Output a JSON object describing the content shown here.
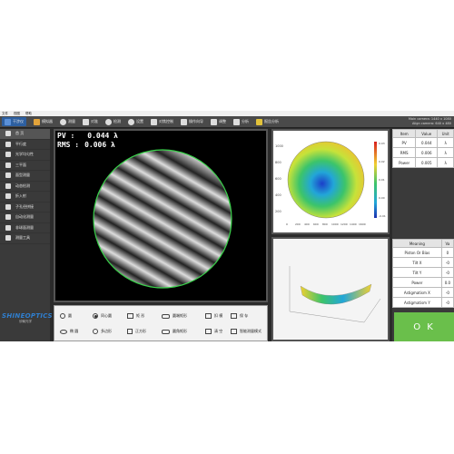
{
  "menubar": {
    "items": [
      "文件",
      "视图",
      "帮助"
    ]
  },
  "toolbar": {
    "items": [
      {
        "label": "干涉仪",
        "icon": "interferometer-icon",
        "active": true
      },
      {
        "label": "模拟器",
        "icon": "simulator-icon",
        "active": false
      },
      {
        "label": "测量",
        "icon": "measure-icon",
        "active": false
      },
      {
        "label": "对准",
        "icon": "align-icon",
        "active": false
      },
      {
        "label": "检测",
        "icon": "detect-icon",
        "active": false
      },
      {
        "label": "设置",
        "icon": "settings-icon",
        "active": false
      },
      {
        "label": "对焦控制",
        "icon": "focus-icon",
        "active": false
      },
      {
        "label": "操作向导",
        "icon": "wizard-icon",
        "active": false
      },
      {
        "label": "调整",
        "icon": "adjust-icon",
        "active": false
      },
      {
        "label": "分析",
        "icon": "analysis-icon",
        "active": false
      },
      {
        "label": "报告分析",
        "icon": "report-icon",
        "active": false
      }
    ],
    "camera_status_1": "Main camera: 1440 x 1080",
    "camera_status_2": "Align camera: 640 x 480"
  },
  "sidebar": {
    "items": [
      {
        "label": "首 页",
        "active": true
      },
      {
        "label": "平行度",
        "active": false
      },
      {
        "label": "光学均匀性",
        "active": false
      },
      {
        "label": "三平面",
        "active": false
      },
      {
        "label": "面型测量",
        "active": false
      },
      {
        "label": "动态检测",
        "active": false
      },
      {
        "label": "折入射",
        "active": false
      },
      {
        "label": "子孔径拼接",
        "active": false
      },
      {
        "label": "自动化测量",
        "active": false
      },
      {
        "label": "非球面测量",
        "active": false
      },
      {
        "label": "测量工具",
        "active": false
      }
    ],
    "logo": "SHINEOPTICS",
    "logo_sub": "欣翰光学"
  },
  "main": {
    "pv_label": "PV :",
    "pv_value": "0.044 λ",
    "rms_label": "RMS :",
    "rms_value": "0.006 λ"
  },
  "controls": {
    "items": [
      "圆",
      "同心圆",
      "矩 形",
      "圆端矩形",
      "扣 模",
      "保 存",
      "椭 圆",
      "多边形",
      "正方形",
      "圆角矩形",
      "清 空",
      "智能测量模式"
    ]
  },
  "table1": {
    "headers": [
      "Item",
      "Value",
      "Unit"
    ],
    "rows": [
      [
        "PV",
        "0.044",
        "λ"
      ],
      [
        "RMS",
        "0.006",
        "λ"
      ],
      [
        "Power",
        "0.005",
        "λ"
      ]
    ]
  },
  "table2": {
    "headers": [
      "Meaning",
      "Va"
    ],
    "rows": [
      [
        "Piston Or Bias",
        "0"
      ],
      [
        "Tilt X",
        "-0"
      ],
      [
        "Tilt Y",
        "-0"
      ],
      [
        "Power",
        "0.0"
      ],
      [
        "Astigmatism X",
        "-0"
      ],
      [
        "Astigmatism Y",
        "-0"
      ]
    ]
  },
  "ok_label": "O K",
  "wave_axes": {
    "y_ticks": [
      "1000",
      "800",
      "600",
      "400",
      "200"
    ],
    "x_ticks": [
      "0",
      "200",
      "400",
      "600",
      "800",
      "1000",
      "1200",
      "1400",
      "1600"
    ],
    "cb_ticks": [
      "0.03",
      "0.02",
      "0.01",
      "0.00",
      "-0.01"
    ]
  },
  "colors": {
    "accent": "#2d5fa0",
    "ok": "#6abf4b",
    "aperture_ring": "#39d24a",
    "logo": "#2f7fd0"
  }
}
